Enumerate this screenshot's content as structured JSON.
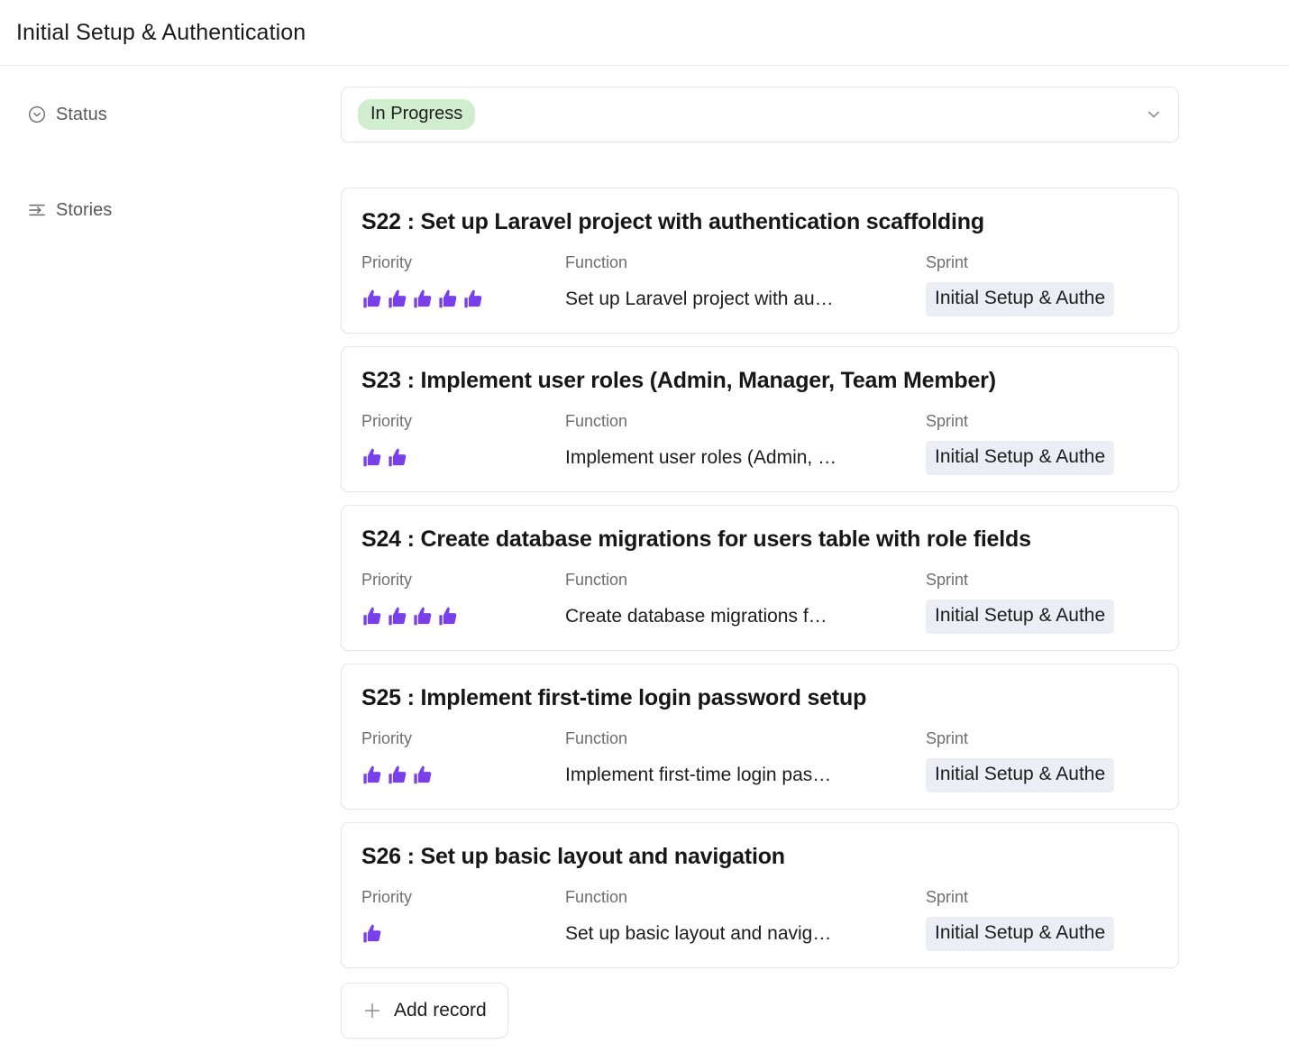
{
  "header": {
    "title": "Initial Setup & Authentication"
  },
  "fields": {
    "status": {
      "label": "Status",
      "icon": "single-select-circle-chevron-icon",
      "value": "In Progress",
      "value_color": "#d0edce",
      "expand_icon": "chevron-down-icon"
    },
    "stories": {
      "label": "Stories",
      "icon": "linked-records-list-icon",
      "column_headers": {
        "priority": "Priority",
        "function": "Function",
        "sprint": "Sprint"
      },
      "priority_icon": "thumbs-up-icon",
      "priority_icon_color": "#7840e8",
      "sprint_tag_color": "#ecedf5",
      "records": [
        {
          "title": "S22 : Set up Laravel project with authentication scaffolding",
          "priority": 5,
          "function": "Set up Laravel project with au…",
          "sprint": "Initial Setup & Authe"
        },
        {
          "title": "S23 : Implement user roles (Admin, Manager, Team Member)",
          "priority": 2,
          "function": "Implement user roles (Admin, …",
          "sprint": "Initial Setup & Authe"
        },
        {
          "title": "S24 : Create database migrations for users table with role fields",
          "priority": 4,
          "function": "Create database migrations f…",
          "sprint": "Initial Setup & Authe"
        },
        {
          "title": "S25 : Implement first-time login password setup",
          "priority": 3,
          "function": "Implement first-time login pas…",
          "sprint": "Initial Setup & Authe"
        },
        {
          "title": "S26 : Set up basic layout and navigation",
          "priority": 1,
          "function": "Set up basic layout and navig…",
          "sprint": "Initial Setup & Authe"
        }
      ],
      "add_record_label": "Add record",
      "add_record_icon": "plus-icon"
    }
  }
}
